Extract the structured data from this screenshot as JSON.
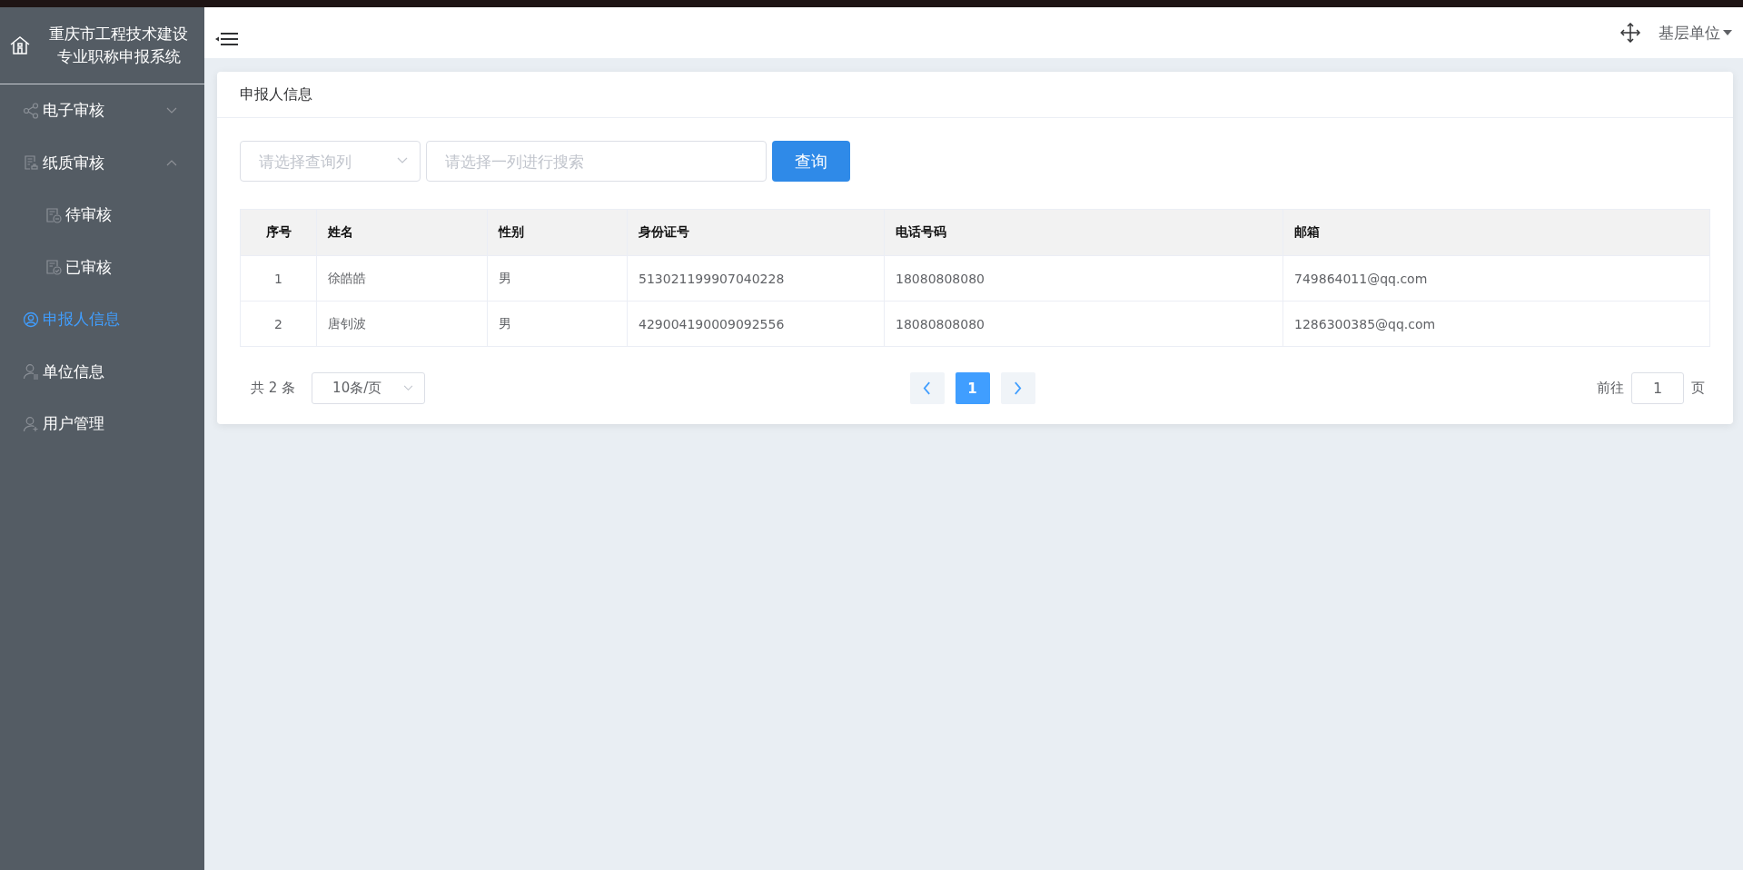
{
  "sidebar": {
    "title_lines": [
      "重庆市工程技术建设",
      "专业职称申报系统"
    ],
    "items": [
      {
        "label": "电子审核",
        "kind": "group",
        "expanded": false,
        "selected": false
      },
      {
        "label": "纸质审核",
        "kind": "group",
        "expanded": true,
        "selected": false,
        "children": [
          {
            "label": "待审核",
            "selected": false
          },
          {
            "label": "已审核",
            "selected": false
          }
        ]
      },
      {
        "label": "申报人信息",
        "kind": "item",
        "selected": true
      },
      {
        "label": "单位信息",
        "kind": "item",
        "selected": false
      },
      {
        "label": "用户管理",
        "kind": "item",
        "selected": false
      }
    ]
  },
  "header": {
    "user": "基层单位"
  },
  "card": {
    "title": "申报人信息",
    "filter": {
      "column_placeholder": "请选择查询列",
      "search_placeholder": "请选择一列进行搜索",
      "button": "查询"
    },
    "table": {
      "columns": [
        "序号",
        "姓名",
        "性别",
        "身份证号",
        "电话号码",
        "邮箱"
      ],
      "rows": [
        [
          "1",
          "徐皓皓",
          "男",
          "513021199907040228",
          "18080808080",
          "749864011@qq.com"
        ],
        [
          "2",
          "唐钊波",
          "男",
          "429004190009092556",
          "18080808080",
          "1286300385@qq.com"
        ]
      ]
    },
    "pagination": {
      "total": "共 2 条",
      "page_size": "10条/页",
      "pages": [
        {
          "label": "1",
          "selected": true
        }
      ],
      "goto_label": "前往",
      "goto_value": "1",
      "goto_suffix": "页"
    }
  }
}
